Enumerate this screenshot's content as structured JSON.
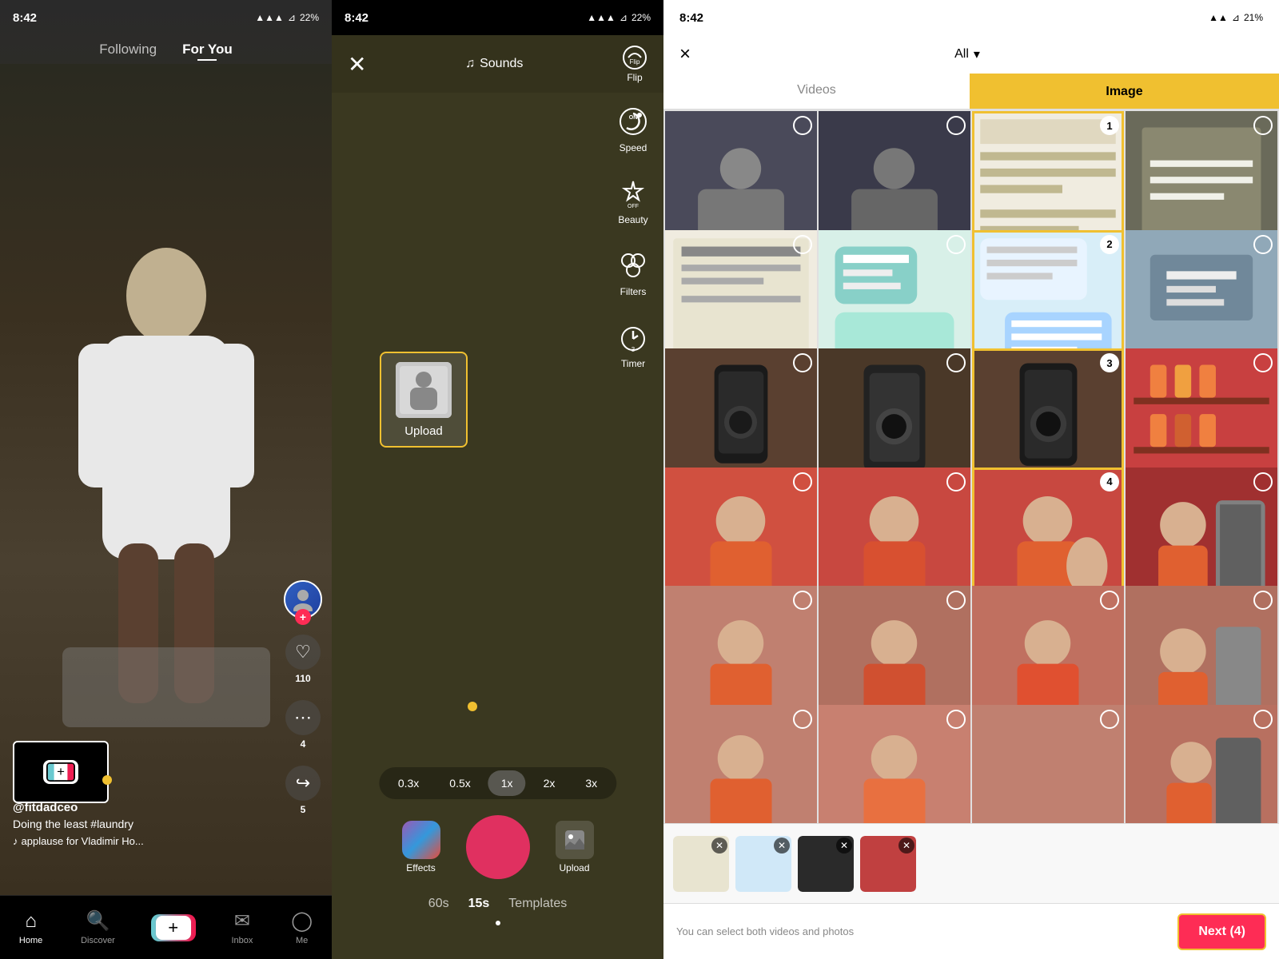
{
  "panel1": {
    "status_time": "8:42",
    "nav_following": "Following",
    "nav_for_you": "For You",
    "username": "@fitdadceo",
    "caption": "Doing the least #laundry",
    "sound": "applause for Vladimir Ho...",
    "likes": "110",
    "comments": "4",
    "shares": "5",
    "bottom_nav": {
      "home": "Home",
      "discover": "Discover",
      "inbox": "Inbox",
      "profile": "Me"
    }
  },
  "panel2": {
    "status_time": "8:42",
    "sounds_label": "Sounds",
    "flip_label": "Flip",
    "speed_label": "Speed",
    "beauty_label": "Beauty",
    "filters_label": "Filters",
    "timer_label": "Timer",
    "upload_label": "Upload",
    "effects_label": "Effects",
    "speeds": [
      "0.3x",
      "0.5x",
      "1x",
      "2x",
      "3x"
    ],
    "active_speed": "1x",
    "duration_tabs": [
      "60s",
      "15s",
      "Templates"
    ],
    "active_duration": "15s"
  },
  "panel3": {
    "status_time": "8:42",
    "filter_all": "All",
    "tab_videos": "Videos",
    "tab_image": "Image",
    "selected_count": 4,
    "next_label": "Next (4)",
    "hint_text": "You can select both videos and photos",
    "close_icon": "×",
    "numbered_cells": [
      1,
      2,
      3,
      4
    ]
  }
}
